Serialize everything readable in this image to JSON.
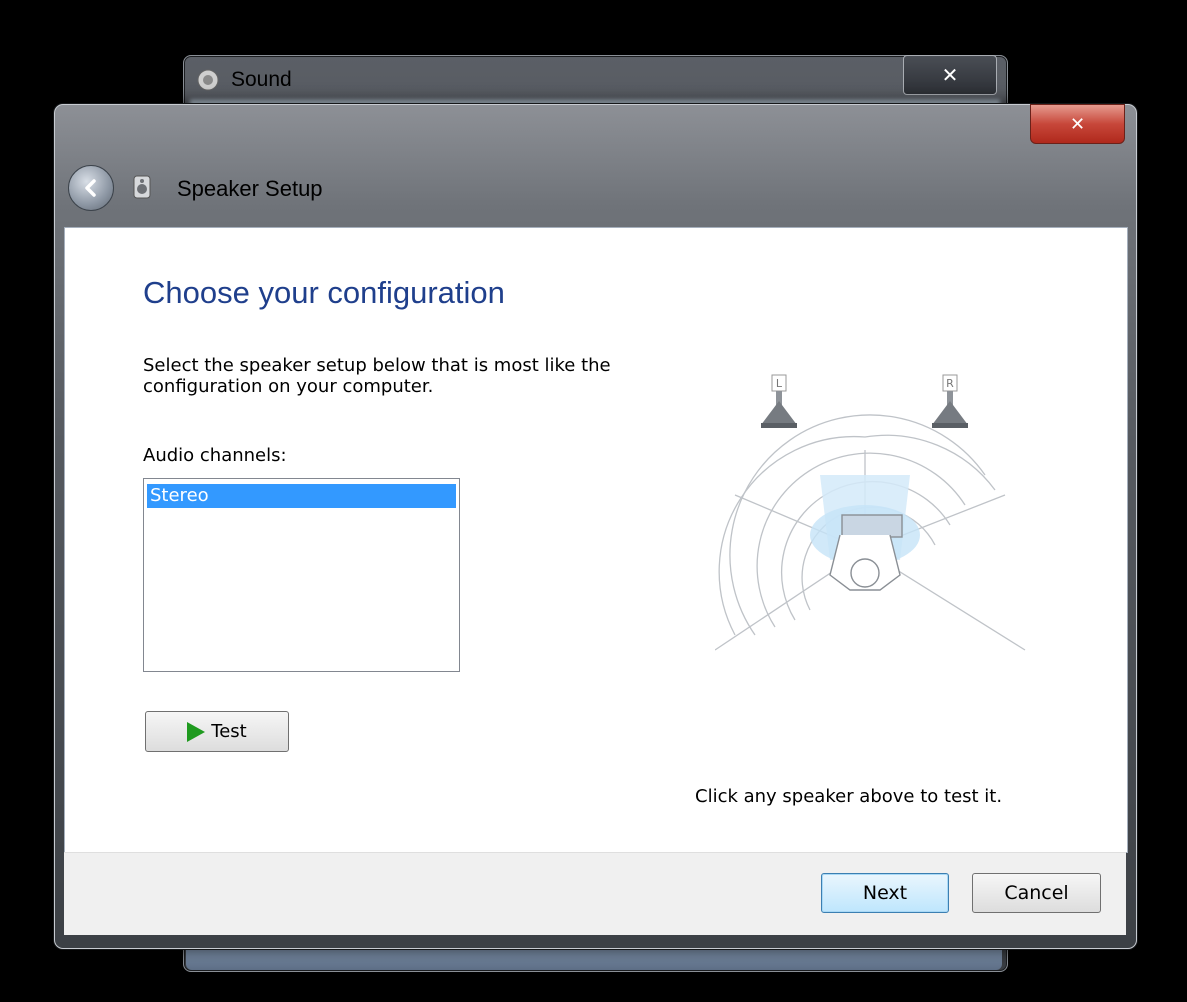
{
  "background_window": {
    "title": "Sound",
    "close_label": "✕"
  },
  "dialog": {
    "title": "Speaker Setup",
    "close_label": "✕",
    "heading": "Choose your configuration",
    "description": "Select the speaker setup below that is most like the configuration on your computer.",
    "channels_label": "Audio channels:",
    "channels": [
      "Stereo"
    ],
    "selected_channel": "Stereo",
    "test_button": "Test",
    "hint": "Click any speaker above to test it.",
    "next_button": "Next",
    "cancel_button": "Cancel",
    "speaker_left_label": "L",
    "speaker_right_label": "R"
  },
  "colors": {
    "heading": "#1f3f8c",
    "selection": "#3399ff",
    "play_icon": "#1f9a1f",
    "close_button": "#c7473a"
  }
}
